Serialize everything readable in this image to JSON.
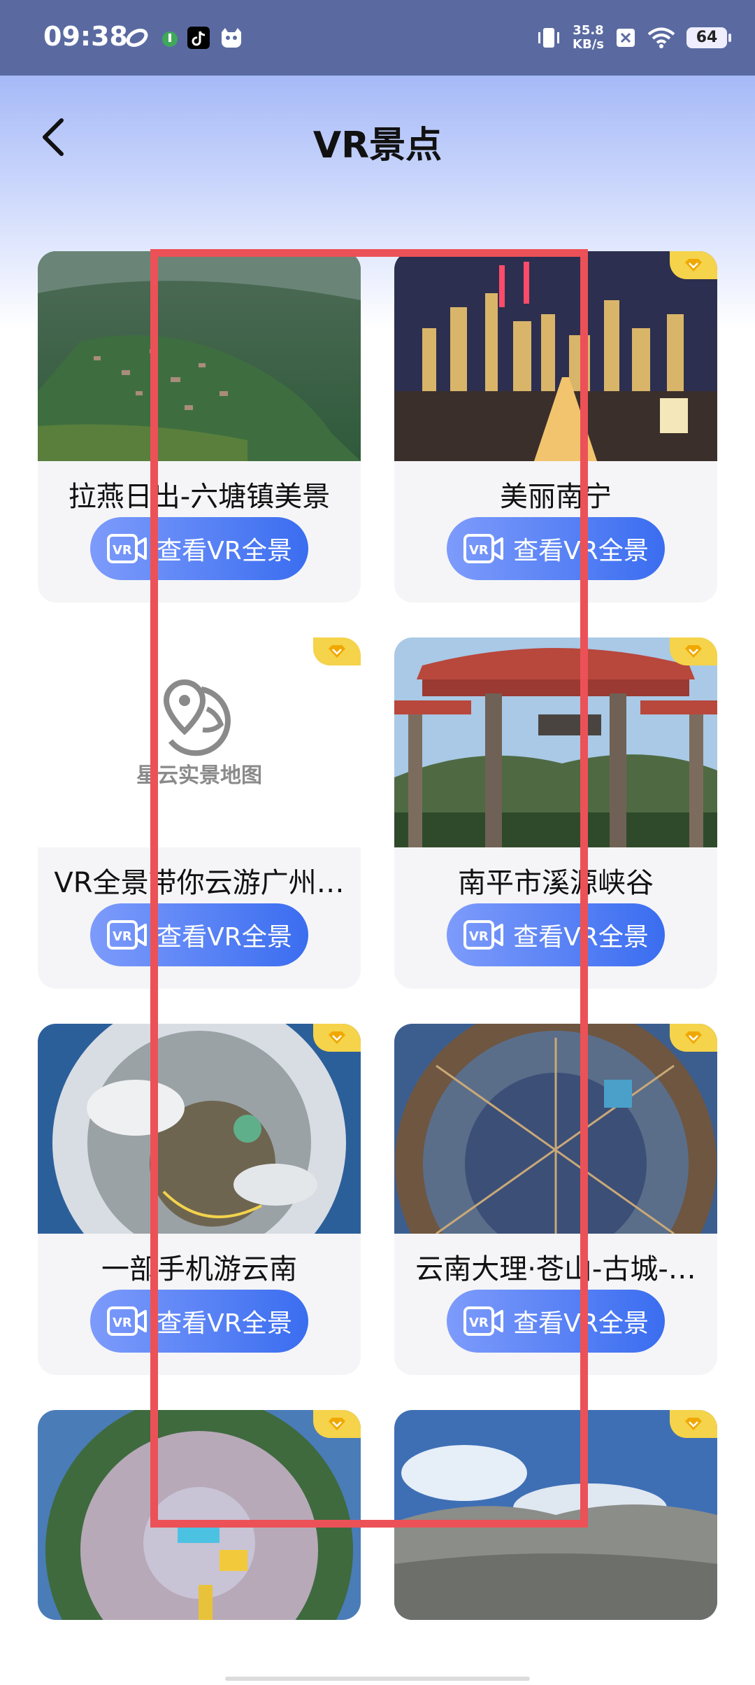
{
  "status_bar": {
    "time": "09:38",
    "net_speed_value": "35.8",
    "net_speed_unit": "KB/s",
    "battery": "64"
  },
  "header": {
    "title": "VR景点"
  },
  "button_label": "查看VR全景",
  "placeholder_logo_text": "星云实景地图",
  "cards": [
    {
      "title": "拉燕日出-六塘镇美景",
      "badge": false
    },
    {
      "title": "美丽南宁",
      "badge": true
    },
    {
      "title": "VR全景带你云游广州…",
      "badge": true
    },
    {
      "title": "南平市溪源峡谷",
      "badge": true
    },
    {
      "title": "一部手机游云南",
      "badge": true
    },
    {
      "title": "云南大理·苍山-古城-…",
      "badge": true
    },
    {
      "title": "",
      "badge": true
    },
    {
      "title": "",
      "badge": true
    }
  ],
  "colors": {
    "accent": "#3a6df0",
    "badge": "#f5d34a",
    "overlay": "#ec5157"
  }
}
